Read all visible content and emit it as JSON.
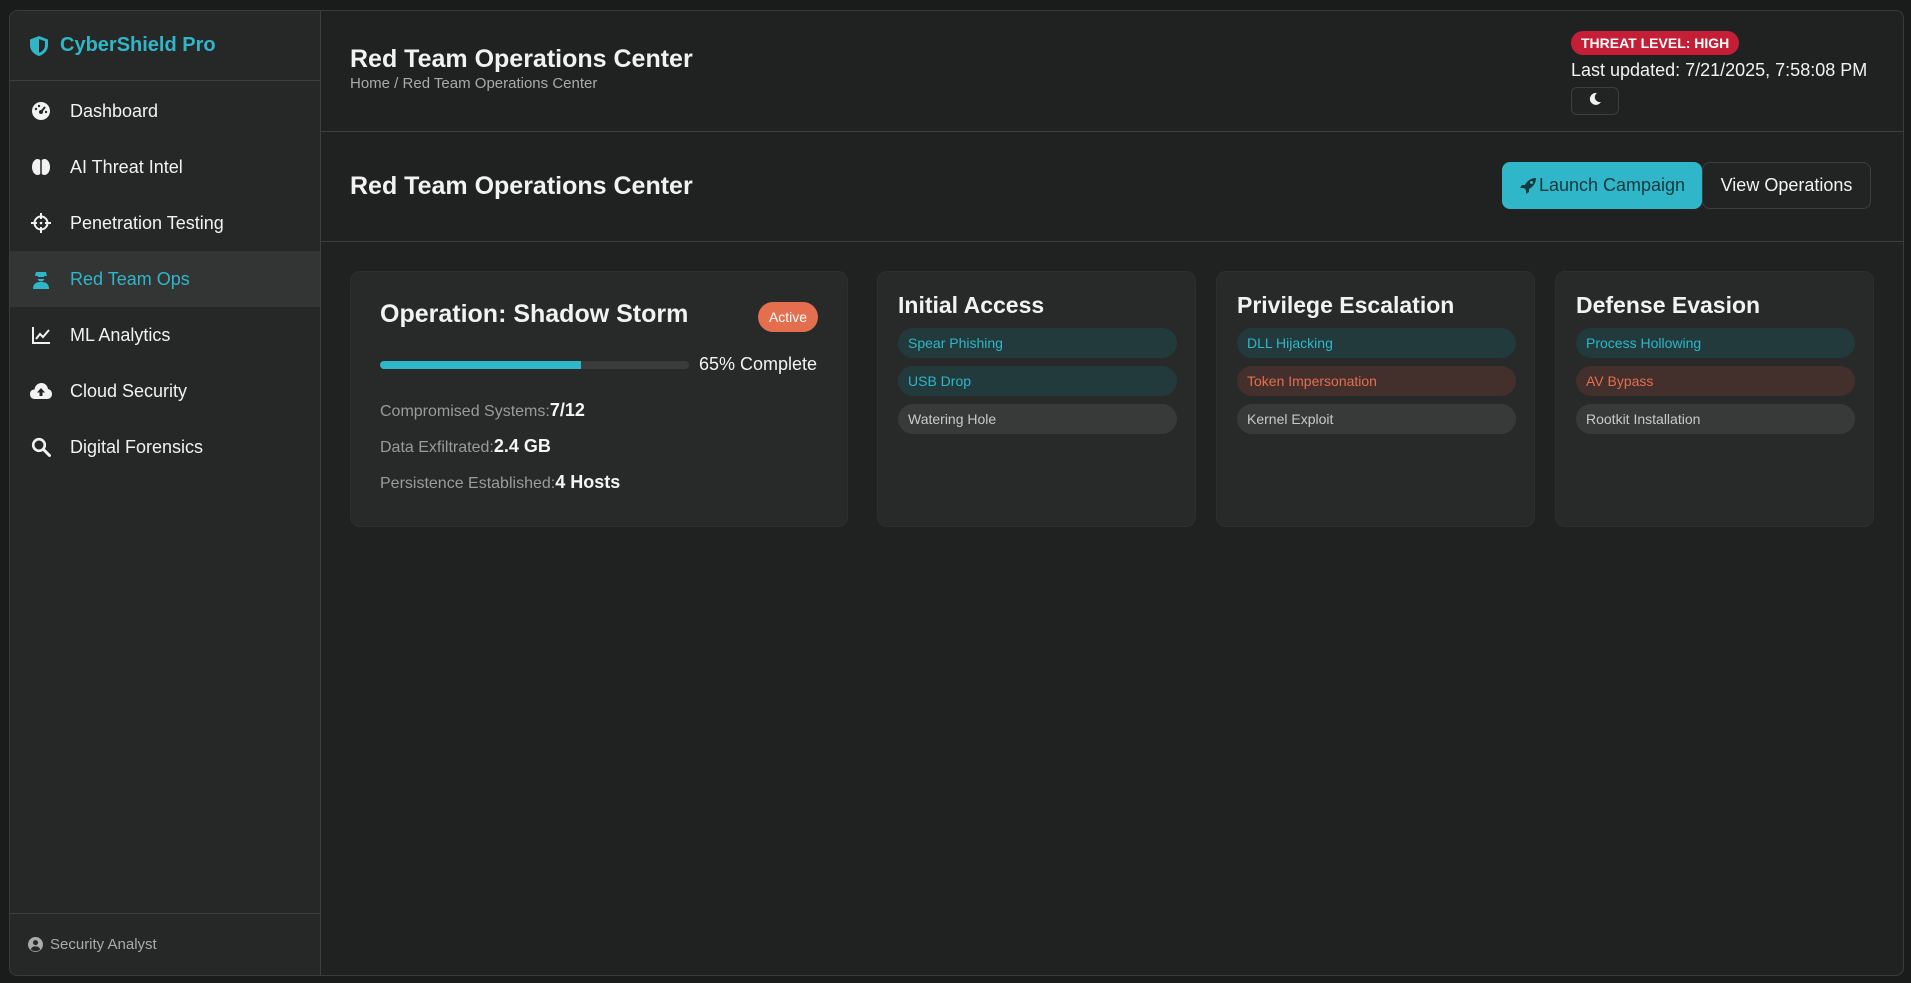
{
  "brand": {
    "name": "CyberShield Pro"
  },
  "sidebar": {
    "items": [
      {
        "label": "Dashboard",
        "icon": "gauge-icon"
      },
      {
        "label": "AI Threat Intel",
        "icon": "brain-icon"
      },
      {
        "label": "Penetration Testing",
        "icon": "crosshairs-icon"
      },
      {
        "label": "Red Team Ops",
        "icon": "user-secret-icon",
        "active": true
      },
      {
        "label": "ML Analytics",
        "icon": "chart-line-icon"
      },
      {
        "label": "Cloud Security",
        "icon": "cloud-upload-icon"
      },
      {
        "label": "Digital Forensics",
        "icon": "search-icon"
      }
    ],
    "footer_user": "Security Analyst"
  },
  "header": {
    "title": "Red Team Operations Center",
    "breadcrumb": "Home / Red Team Operations Center",
    "threat_level": "THREAT LEVEL: HIGH",
    "last_updated": "Last updated: 7/21/2025, 7:58:08 PM"
  },
  "actions": {
    "title": "Red Team Operations Center",
    "launch_label": "Launch Campaign",
    "view_label": "View Operations"
  },
  "operation": {
    "title": "Operation: Shadow Storm",
    "status": "Active",
    "progress_percent": 65,
    "progress_text": "65% Complete",
    "stats": [
      {
        "label": "Compromised Systems:",
        "value": "7/12"
      },
      {
        "label": "Data Exfiltrated:",
        "value": "2.4 GB"
      },
      {
        "label": "Persistence Established:",
        "value": "4 Hosts"
      }
    ]
  },
  "tactics": [
    {
      "title": "Initial Access",
      "techniques": [
        {
          "label": "Spear Phishing",
          "state": "teal"
        },
        {
          "label": "USB Drop",
          "state": "teal"
        },
        {
          "label": "Watering Hole",
          "state": "gray"
        }
      ]
    },
    {
      "title": "Privilege Escalation",
      "techniques": [
        {
          "label": "DLL Hijacking",
          "state": "teal"
        },
        {
          "label": "Token Impersonation",
          "state": "orange"
        },
        {
          "label": "Kernel Exploit",
          "state": "gray"
        }
      ]
    },
    {
      "title": "Defense Evasion",
      "techniques": [
        {
          "label": "Process Hollowing",
          "state": "teal"
        },
        {
          "label": "AV Bypass",
          "state": "orange"
        },
        {
          "label": "Rootkit Installation",
          "state": "gray"
        }
      ]
    }
  ],
  "colors": {
    "accent": "#2fb6c9",
    "danger": "#c41f36",
    "warning": "#e36f4f"
  }
}
